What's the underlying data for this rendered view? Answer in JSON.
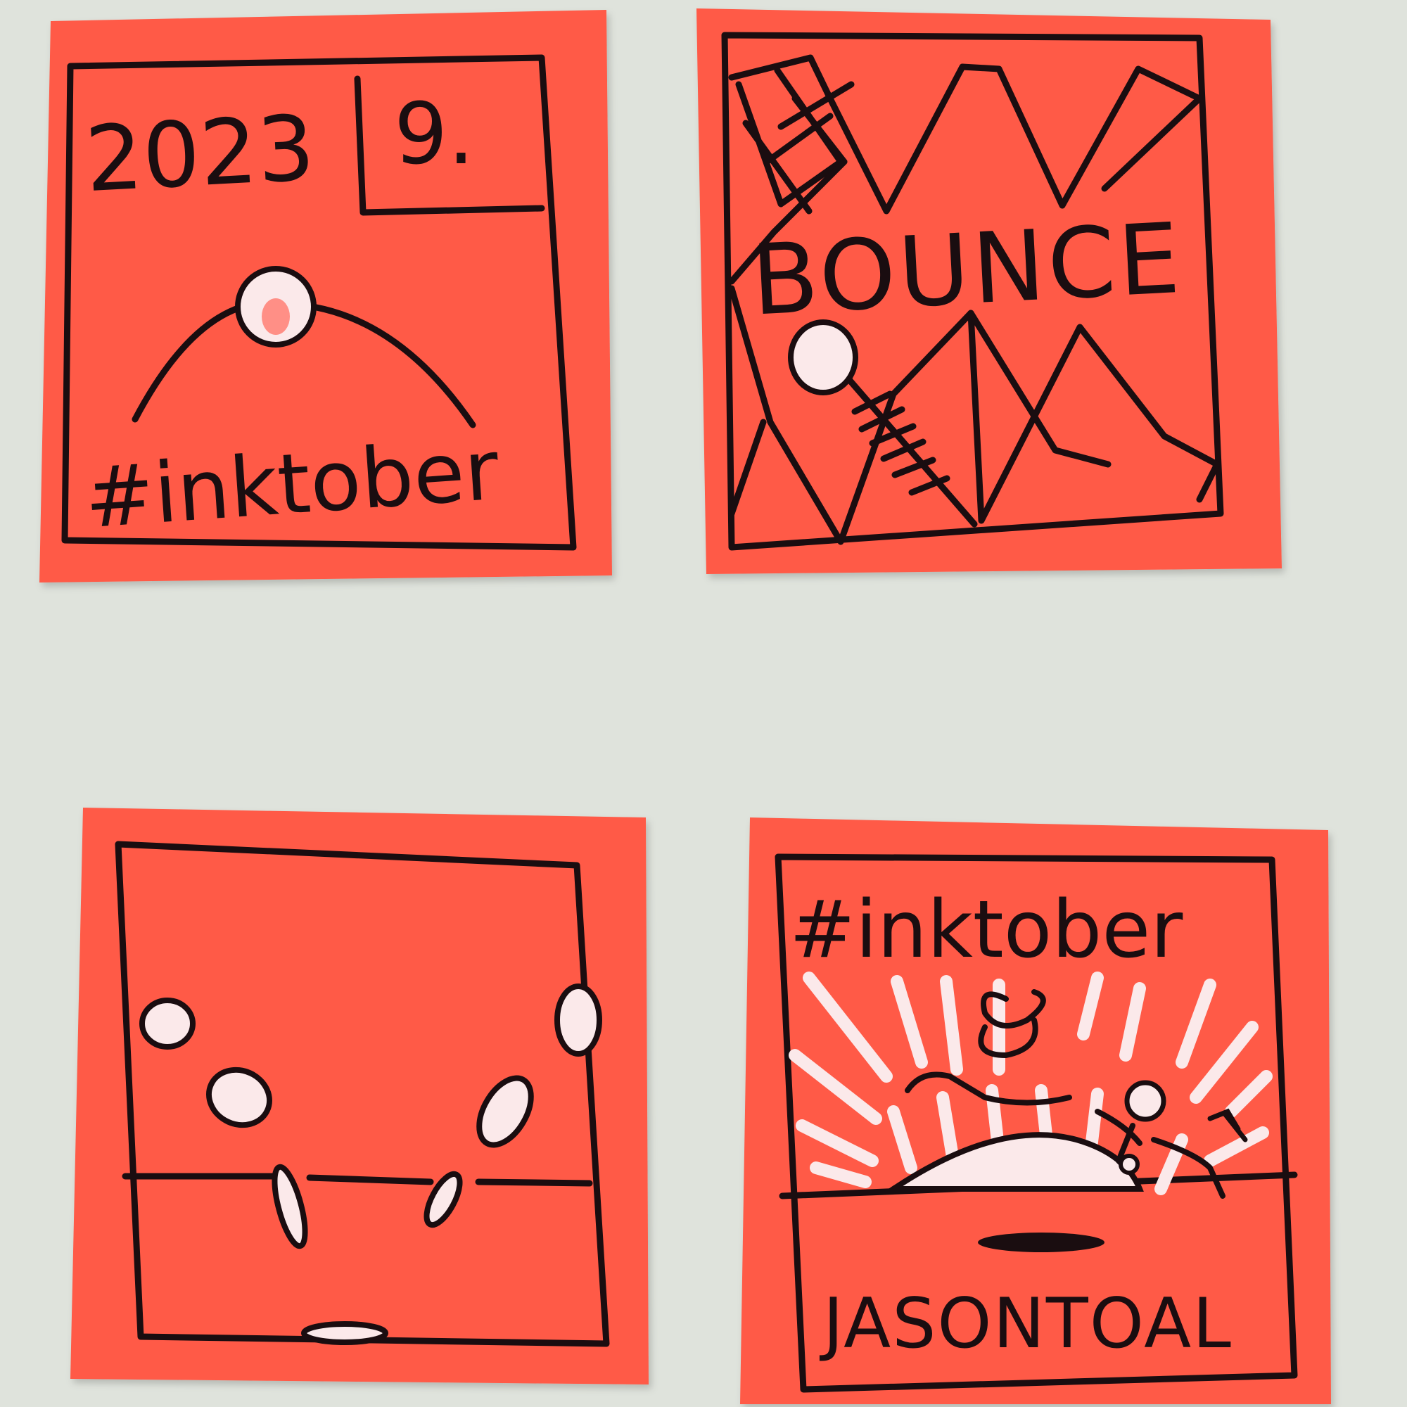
{
  "colors": {
    "wall": "#dfe3dc",
    "note": "#ff5a47",
    "ink": "#1a0d10",
    "highlight": "#fbe9ea"
  },
  "notes": [
    {
      "id": "note-1",
      "year": "2023",
      "day": "9.",
      "hashtag": "#inktober"
    },
    {
      "id": "note-2",
      "word": "BOUNCE"
    },
    {
      "id": "note-3"
    },
    {
      "id": "note-4",
      "hashtag": "#inktober",
      "signature": "JASONTOAL"
    }
  ]
}
